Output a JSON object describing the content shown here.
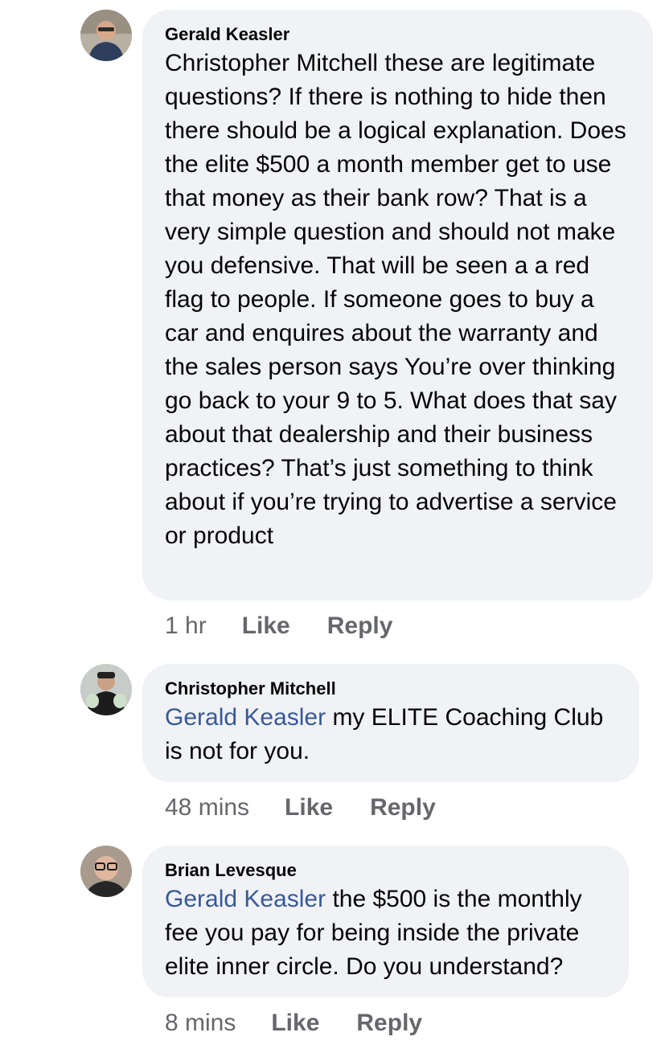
{
  "comments": [
    {
      "author": "Gerald Keasler",
      "mention": "",
      "text": "Christopher Mitchell these are legitimate questions? If there is nothing to hide then there should be a logical explanation. Does the elite $500 a month member get to use that money as their bank row? That is a very simple question and should not make you defensive. That will be seen a a red flag to people. If someone goes to buy a car and enquires about the warranty and the sales person says You’re over thinking go back to your 9 to 5. What does that say about that dealership and their business practices? That’s just something to think about if you’re trying to advertise a service or product",
      "time": "1 hr",
      "like": "Like",
      "reply": "Reply"
    },
    {
      "author": "Christopher Mitchell",
      "mention": "Gerald Keasler",
      "text": " my ELITE Coaching Club is not for you.",
      "time": "48 mins",
      "like": "Like",
      "reply": "Reply"
    },
    {
      "author": "Brian Levesque",
      "mention": "Gerald Keasler",
      "text": " the $500 is the monthly fee you pay for being inside the private elite inner circle. Do you understand?",
      "time": "8 mins",
      "like": "Like",
      "reply": "Reply"
    }
  ],
  "colors": {
    "bubble": "#f0f2f5",
    "mention": "#385898",
    "meta": "#65676b"
  }
}
